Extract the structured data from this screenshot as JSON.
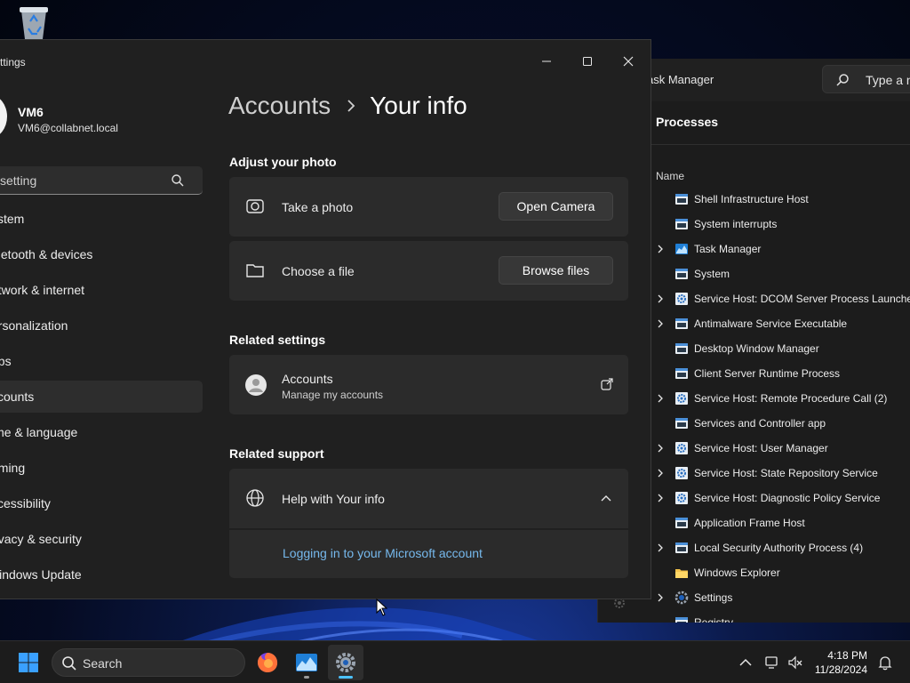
{
  "settings": {
    "title": "ttings",
    "user": {
      "name": "VM6",
      "email": "VM6@collabnet.local"
    },
    "search": {
      "placeholder": "setting"
    },
    "nav": [
      {
        "label": "ystem",
        "active": false
      },
      {
        "label": "luetooth & devices",
        "active": false
      },
      {
        "label": "etwork & internet",
        "active": false
      },
      {
        "label": "ersonalization",
        "active": false
      },
      {
        "label": "pps",
        "active": false
      },
      {
        "label": "ccounts",
        "active": true
      },
      {
        "label": "ime & language",
        "active": false
      },
      {
        "label": "aming",
        "active": false
      },
      {
        "label": "ccessibility",
        "active": false
      },
      {
        "label": "rivacy & security",
        "active": false
      },
      {
        "label": "Vindows Update",
        "active": false
      }
    ],
    "breadcrumb": {
      "parent": "Accounts",
      "current": "Your info"
    },
    "adjust_photo": {
      "heading": "Adjust your photo",
      "take_photo_label": "Take a photo",
      "open_camera_button": "Open Camera",
      "choose_file_label": "Choose a file",
      "browse_files_button": "Browse files"
    },
    "related_settings": {
      "heading": "Related settings",
      "accounts_title": "Accounts",
      "accounts_subtitle": "Manage my accounts"
    },
    "related_support": {
      "heading": "Related support",
      "help_title": "Help with Your info",
      "link": "Logging in to your Microsoft account"
    }
  },
  "task_manager": {
    "title": "ask Manager",
    "search_placeholder": "Type a n",
    "heading": "Processes",
    "column_name": "Name",
    "processes": [
      {
        "name": "Shell Infrastructure Host",
        "expandable": false,
        "icon": "window-icon"
      },
      {
        "name": "System interrupts",
        "expandable": false,
        "icon": "window-icon"
      },
      {
        "name": "Task Manager",
        "expandable": true,
        "icon": "task-manager-icon"
      },
      {
        "name": "System",
        "expandable": false,
        "icon": "window-icon"
      },
      {
        "name": "Service Host: DCOM Server Process Launcher (",
        "expandable": true,
        "icon": "service-gear-icon"
      },
      {
        "name": "Antimalware Service Executable",
        "expandable": true,
        "icon": "window-icon"
      },
      {
        "name": "Desktop Window Manager",
        "expandable": false,
        "icon": "window-icon"
      },
      {
        "name": "Client Server Runtime Process",
        "expandable": false,
        "icon": "window-icon"
      },
      {
        "name": "Service Host: Remote Procedure Call (2)",
        "expandable": true,
        "icon": "service-gear-icon"
      },
      {
        "name": "Services and Controller app",
        "expandable": false,
        "icon": "window-icon"
      },
      {
        "name": "Service Host: User Manager",
        "expandable": true,
        "icon": "service-gear-icon"
      },
      {
        "name": "Service Host: State Repository Service",
        "expandable": true,
        "icon": "service-gear-icon"
      },
      {
        "name": "Service Host: Diagnostic Policy Service",
        "expandable": true,
        "icon": "service-gear-icon"
      },
      {
        "name": "Application Frame Host",
        "expandable": false,
        "icon": "window-icon"
      },
      {
        "name": "Local Security Authority Process (4)",
        "expandable": true,
        "icon": "window-icon"
      },
      {
        "name": "Windows Explorer",
        "expandable": false,
        "icon": "folder-icon"
      },
      {
        "name": "Settings",
        "expandable": true,
        "icon": "settings-gear-icon"
      },
      {
        "name": "Registry",
        "expandable": false,
        "icon": "window-icon"
      }
    ]
  },
  "taskbar": {
    "search_label": "Search",
    "clock_time": "4:18 PM",
    "clock_date": "11/28/2024"
  },
  "colors": {
    "accent_link": "#76b9ed",
    "window_bg": "#202020",
    "card_bg": "#2b2b2b",
    "taskbar_bg": "#1c1c1c"
  }
}
